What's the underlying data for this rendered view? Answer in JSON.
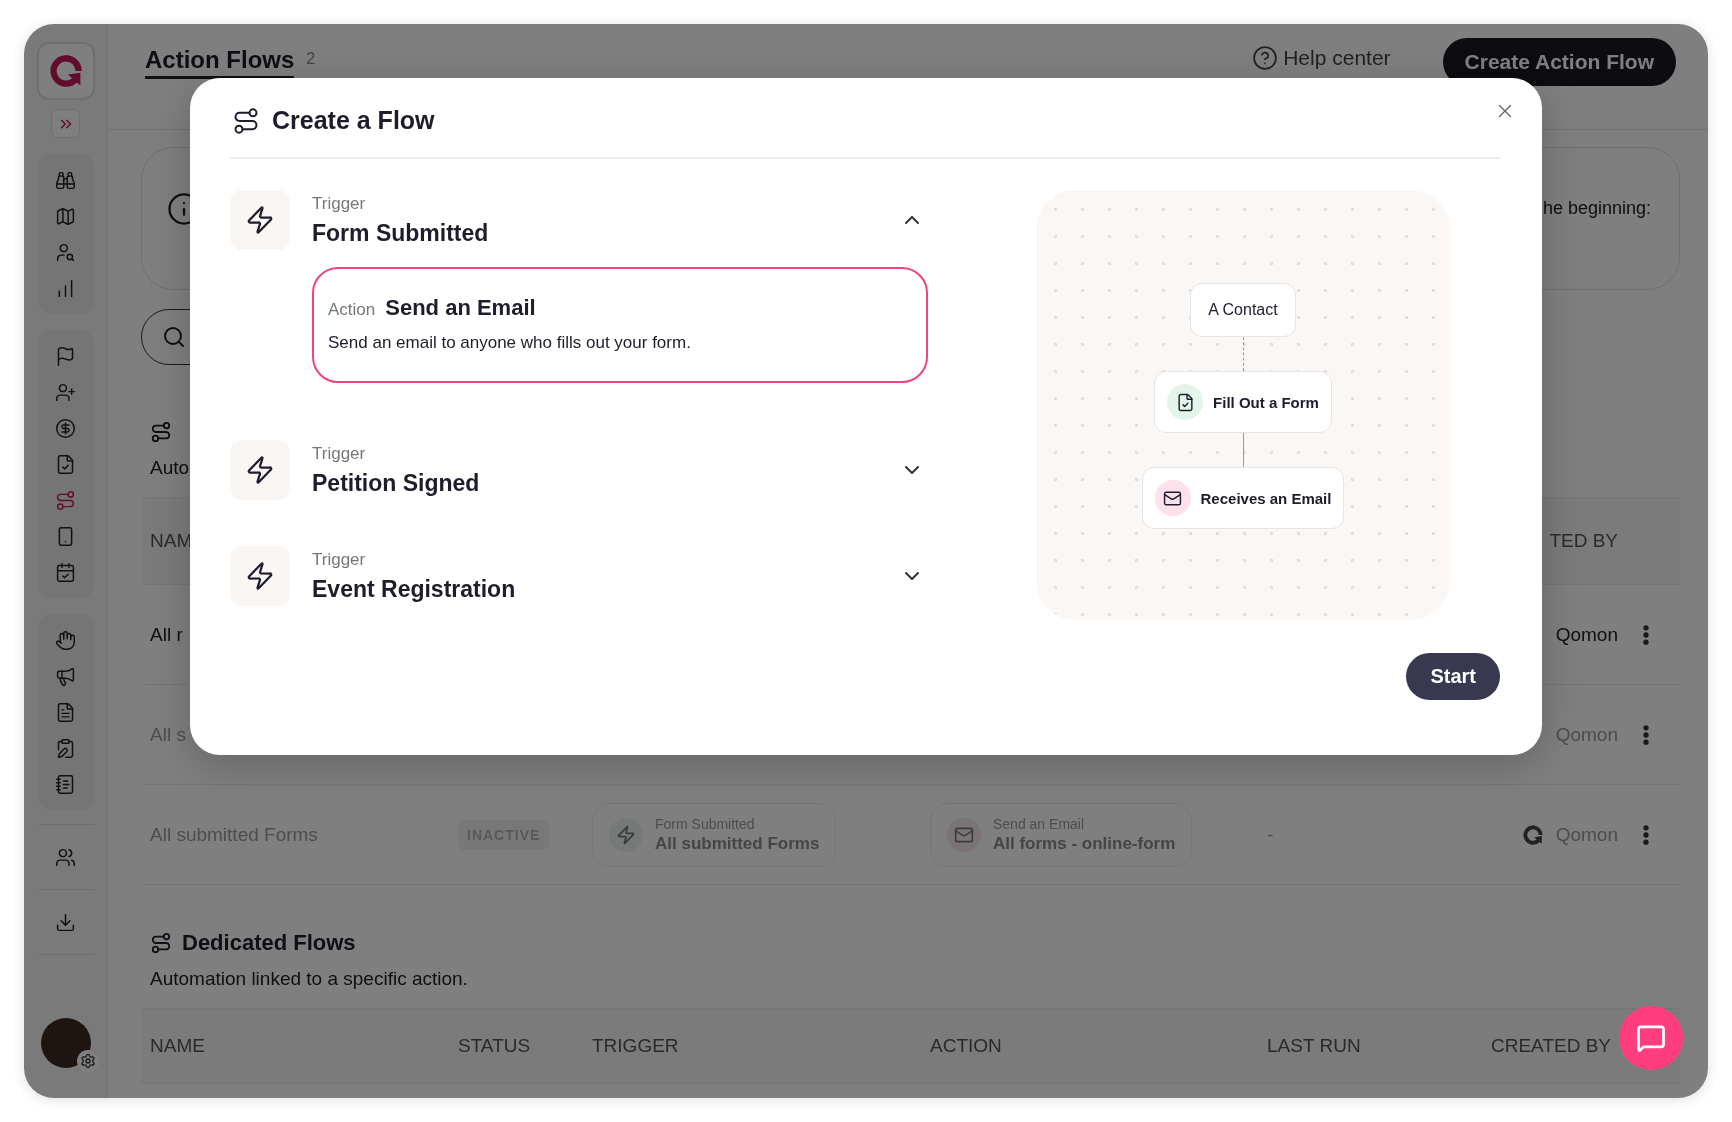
{
  "sidebar": {
    "groups": [
      {
        "items": [
          {
            "selected": false
          },
          {
            "selected": false
          },
          {
            "selected": false
          },
          {
            "selected": false
          }
        ]
      },
      {
        "items": [
          {
            "selected": false
          },
          {
            "selected": false
          },
          {
            "selected": false
          },
          {
            "selected": false
          },
          {
            "selected": true
          },
          {
            "selected": false
          },
          {
            "selected": false
          }
        ]
      },
      {
        "items": [
          {
            "selected": false
          },
          {
            "selected": false
          },
          {
            "selected": false
          },
          {
            "selected": false
          },
          {
            "selected": false
          }
        ]
      }
    ],
    "bottom_items": [
      {
        "selected": false
      },
      {
        "selected": false
      }
    ]
  },
  "page": {
    "title": "Action Flows",
    "count": "2",
    "help_link": "Help center",
    "create_button": "Create Action Flow"
  },
  "info_banner": {
    "text": "he beginning:"
  },
  "automated_flows": {
    "description": "Auto",
    "column_headers": {
      "name": "NAM",
      "created_by": "TED BY"
    },
    "rows": [
      {
        "name": "All r",
        "created_by": "Qomon",
        "inactive": false
      },
      {
        "name": "All s",
        "created_by": "Qomon",
        "inactive": true
      },
      {
        "name": "All submitted Forms",
        "status": "INACTIVE",
        "trigger": {
          "label": "Form Submitted",
          "value": "All submitted Forms"
        },
        "action": {
          "label": "Send an Email",
          "value": "All forms - online-form"
        },
        "last_run": "-",
        "created_by": "Qomon",
        "creator_logo": true,
        "inactive": true
      }
    ]
  },
  "dedicated_flows": {
    "title": "Dedicated Flows",
    "description": "Automation linked to a specific action.",
    "columns": [
      "NAME",
      "STATUS",
      "TRIGGER",
      "ACTION",
      "LAST RUN",
      "CREATED BY"
    ]
  },
  "modal": {
    "title": "Create a Flow",
    "triggers": [
      {
        "label": "Trigger",
        "name": "Form Submitted",
        "expanded": true,
        "actions": [
          {
            "label": "Action",
            "name": "Send an Email",
            "description": "Send an email to anyone who fills out your form.",
            "selected": true
          }
        ]
      },
      {
        "label": "Trigger",
        "name": "Petition Signed",
        "expanded": false
      },
      {
        "label": "Trigger",
        "name": "Event Registration",
        "expanded": false
      }
    ],
    "diagram": {
      "nodes": [
        {
          "kind": "start",
          "label": "A Contact"
        },
        {
          "kind": "form",
          "label": "Fill Out a Form"
        },
        {
          "kind": "email",
          "label": "Receives an Email"
        }
      ]
    },
    "start_button": "Start"
  }
}
